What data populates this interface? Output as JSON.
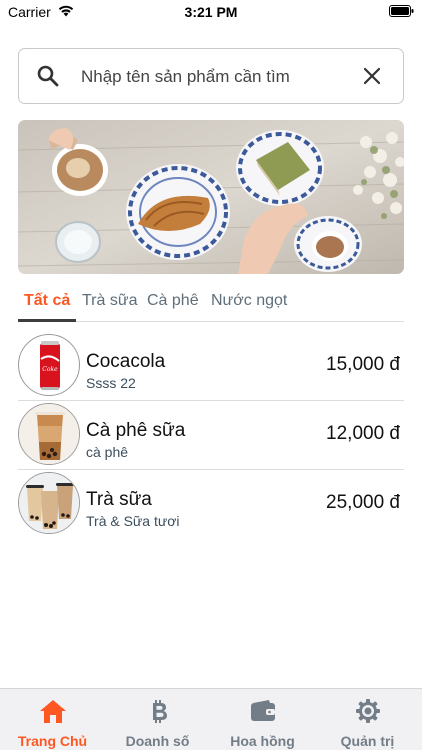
{
  "status_bar": {
    "carrier": "Carrier",
    "time": "3:21 PM"
  },
  "search": {
    "placeholder": "Nhập tên sản phẩm cần tìm",
    "value": ""
  },
  "banner": {
    "icon": "banner-image"
  },
  "tabs": [
    {
      "label": "Tất cả",
      "active": true
    },
    {
      "label": "Trà sữa",
      "active": false
    },
    {
      "label": "Cà phê",
      "active": false
    },
    {
      "label": "Nước ngọt",
      "active": false
    }
  ],
  "products": [
    {
      "name": "Cocacola",
      "category": "Ssss 22",
      "price": "15,000 đ",
      "icon": "cola-can"
    },
    {
      "name": "Cà phê sữa",
      "category": "cà phê",
      "price": "12,000 đ",
      "icon": "coffee-cup"
    },
    {
      "name": "Trà sữa",
      "category": "Trà & Sữa tươi",
      "price": "25,000 đ",
      "icon": "milk-tea-cups"
    }
  ],
  "bottom_nav": [
    {
      "label": "Trang Chủ",
      "icon": "home-icon",
      "active": true
    },
    {
      "label": "Doanh số",
      "icon": "bitcoin-icon",
      "active": false
    },
    {
      "label": "Hoa hồng",
      "icon": "wallet-icon",
      "active": false
    },
    {
      "label": "Quản trị",
      "icon": "settings-icon",
      "active": false
    }
  ],
  "colors": {
    "accent": "#ff5722",
    "inactive": "#737d88",
    "tab_inactive": "#5e6e7a",
    "nav_background": "#f1f1f3"
  }
}
